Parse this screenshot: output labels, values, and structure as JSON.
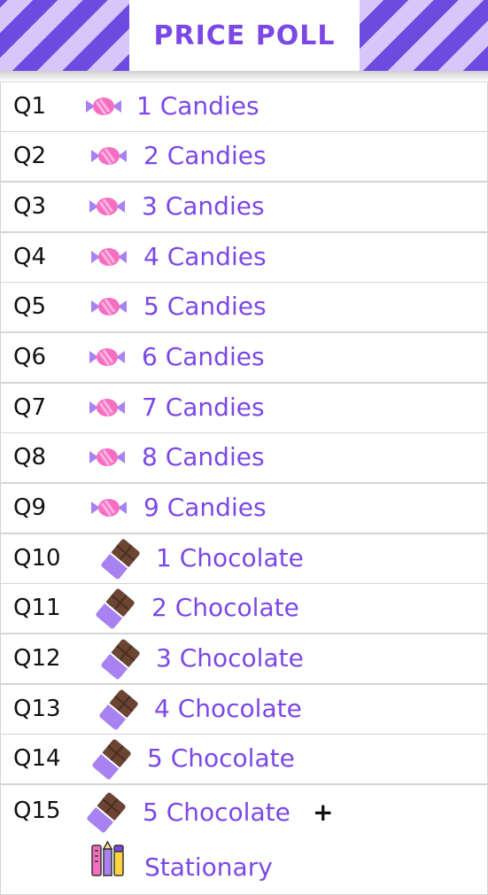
{
  "header": {
    "title": "PRICE POLL"
  },
  "rows": [
    {
      "q": "Q1",
      "reward": "1 Candies",
      "icon": "candy-icon"
    },
    {
      "q": "Q2",
      "reward": "2 Candies",
      "icon": "candy-icon"
    },
    {
      "q": "Q3",
      "reward": "3 Candies",
      "icon": "candy-icon"
    },
    {
      "q": "Q4",
      "reward": "4 Candies",
      "icon": "candy-icon"
    },
    {
      "q": "Q5",
      "reward": "5 Candies",
      "icon": "candy-icon"
    },
    {
      "q": "Q6",
      "reward": "6 Candies",
      "icon": "candy-icon"
    },
    {
      "q": "Q7",
      "reward": "7 Candies",
      "icon": "candy-icon"
    },
    {
      "q": "Q8",
      "reward": "8 Candies",
      "icon": "candy-icon"
    },
    {
      "q": "Q9",
      "reward": "9 Candies",
      "icon": "candy-icon"
    },
    {
      "q": "Q10",
      "reward": "1 Chocolate",
      "icon": "chocolate-icon"
    },
    {
      "q": "Q11",
      "reward": "2 Chocolate",
      "icon": "chocolate-icon"
    },
    {
      "q": "Q12",
      "reward": "3 Chocolate",
      "icon": "chocolate-icon"
    },
    {
      "q": "Q13",
      "reward": "4 Chocolate",
      "icon": "chocolate-icon"
    },
    {
      "q": "Q14",
      "reward": "5 Chocolate",
      "icon": "chocolate-icon"
    },
    {
      "q": "Q15",
      "reward": "5 Chocolate",
      "plus": "+",
      "reward2": "Stationary",
      "icon": "chocolate-icon",
      "icon2": "stationery-icon"
    }
  ],
  "colors": {
    "accent": "#7b48e6",
    "stripe_dark": "#6d4be0",
    "stripe_light": "#d6c7fb",
    "candy_pink": "#f56ec2"
  }
}
